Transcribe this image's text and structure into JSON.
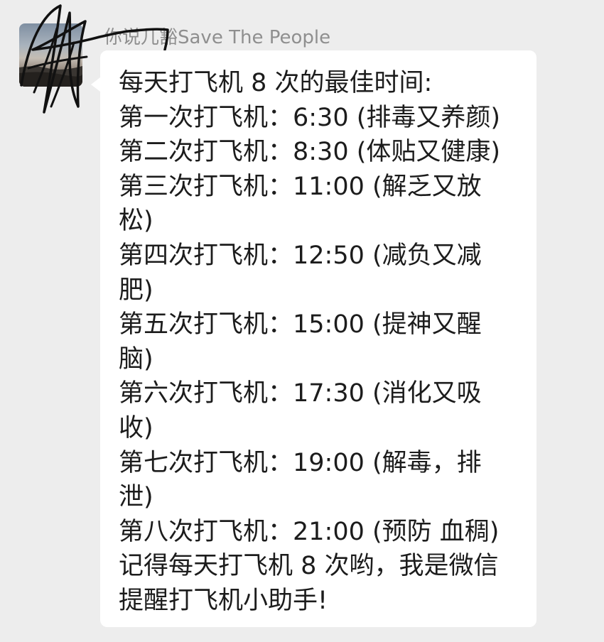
{
  "message": {
    "sender_name": "你说儿豁Save The People",
    "lines": [
      "每天打飞机 8 次的最佳时间:",
      "第一次打飞机：6:30 (排毒又养颜)",
      "第二次打飞机：8:30 (体贴又健康)",
      "第三次打飞机：11:00 (解乏又放",
      "松)",
      "第四次打飞机：12:50 (减负又减",
      "肥)",
      "第五次打飞机：15:00 (提神又醒",
      "脑)",
      "第六次打飞机：17:30 (消化又吸",
      "收)",
      "第七次打飞机：19:00 (解毒，排",
      "泄)",
      "第八次打飞机：21:00 (预防 血稠)",
      "记得每天打飞机 8 次哟，我是微信",
      "提醒打飞机小助手!"
    ]
  },
  "colors": {
    "background": "#ededed",
    "bubble": "#ffffff",
    "text": "#1c1c1c",
    "sender": "#8f8f8f",
    "scribble": "#111111"
  }
}
